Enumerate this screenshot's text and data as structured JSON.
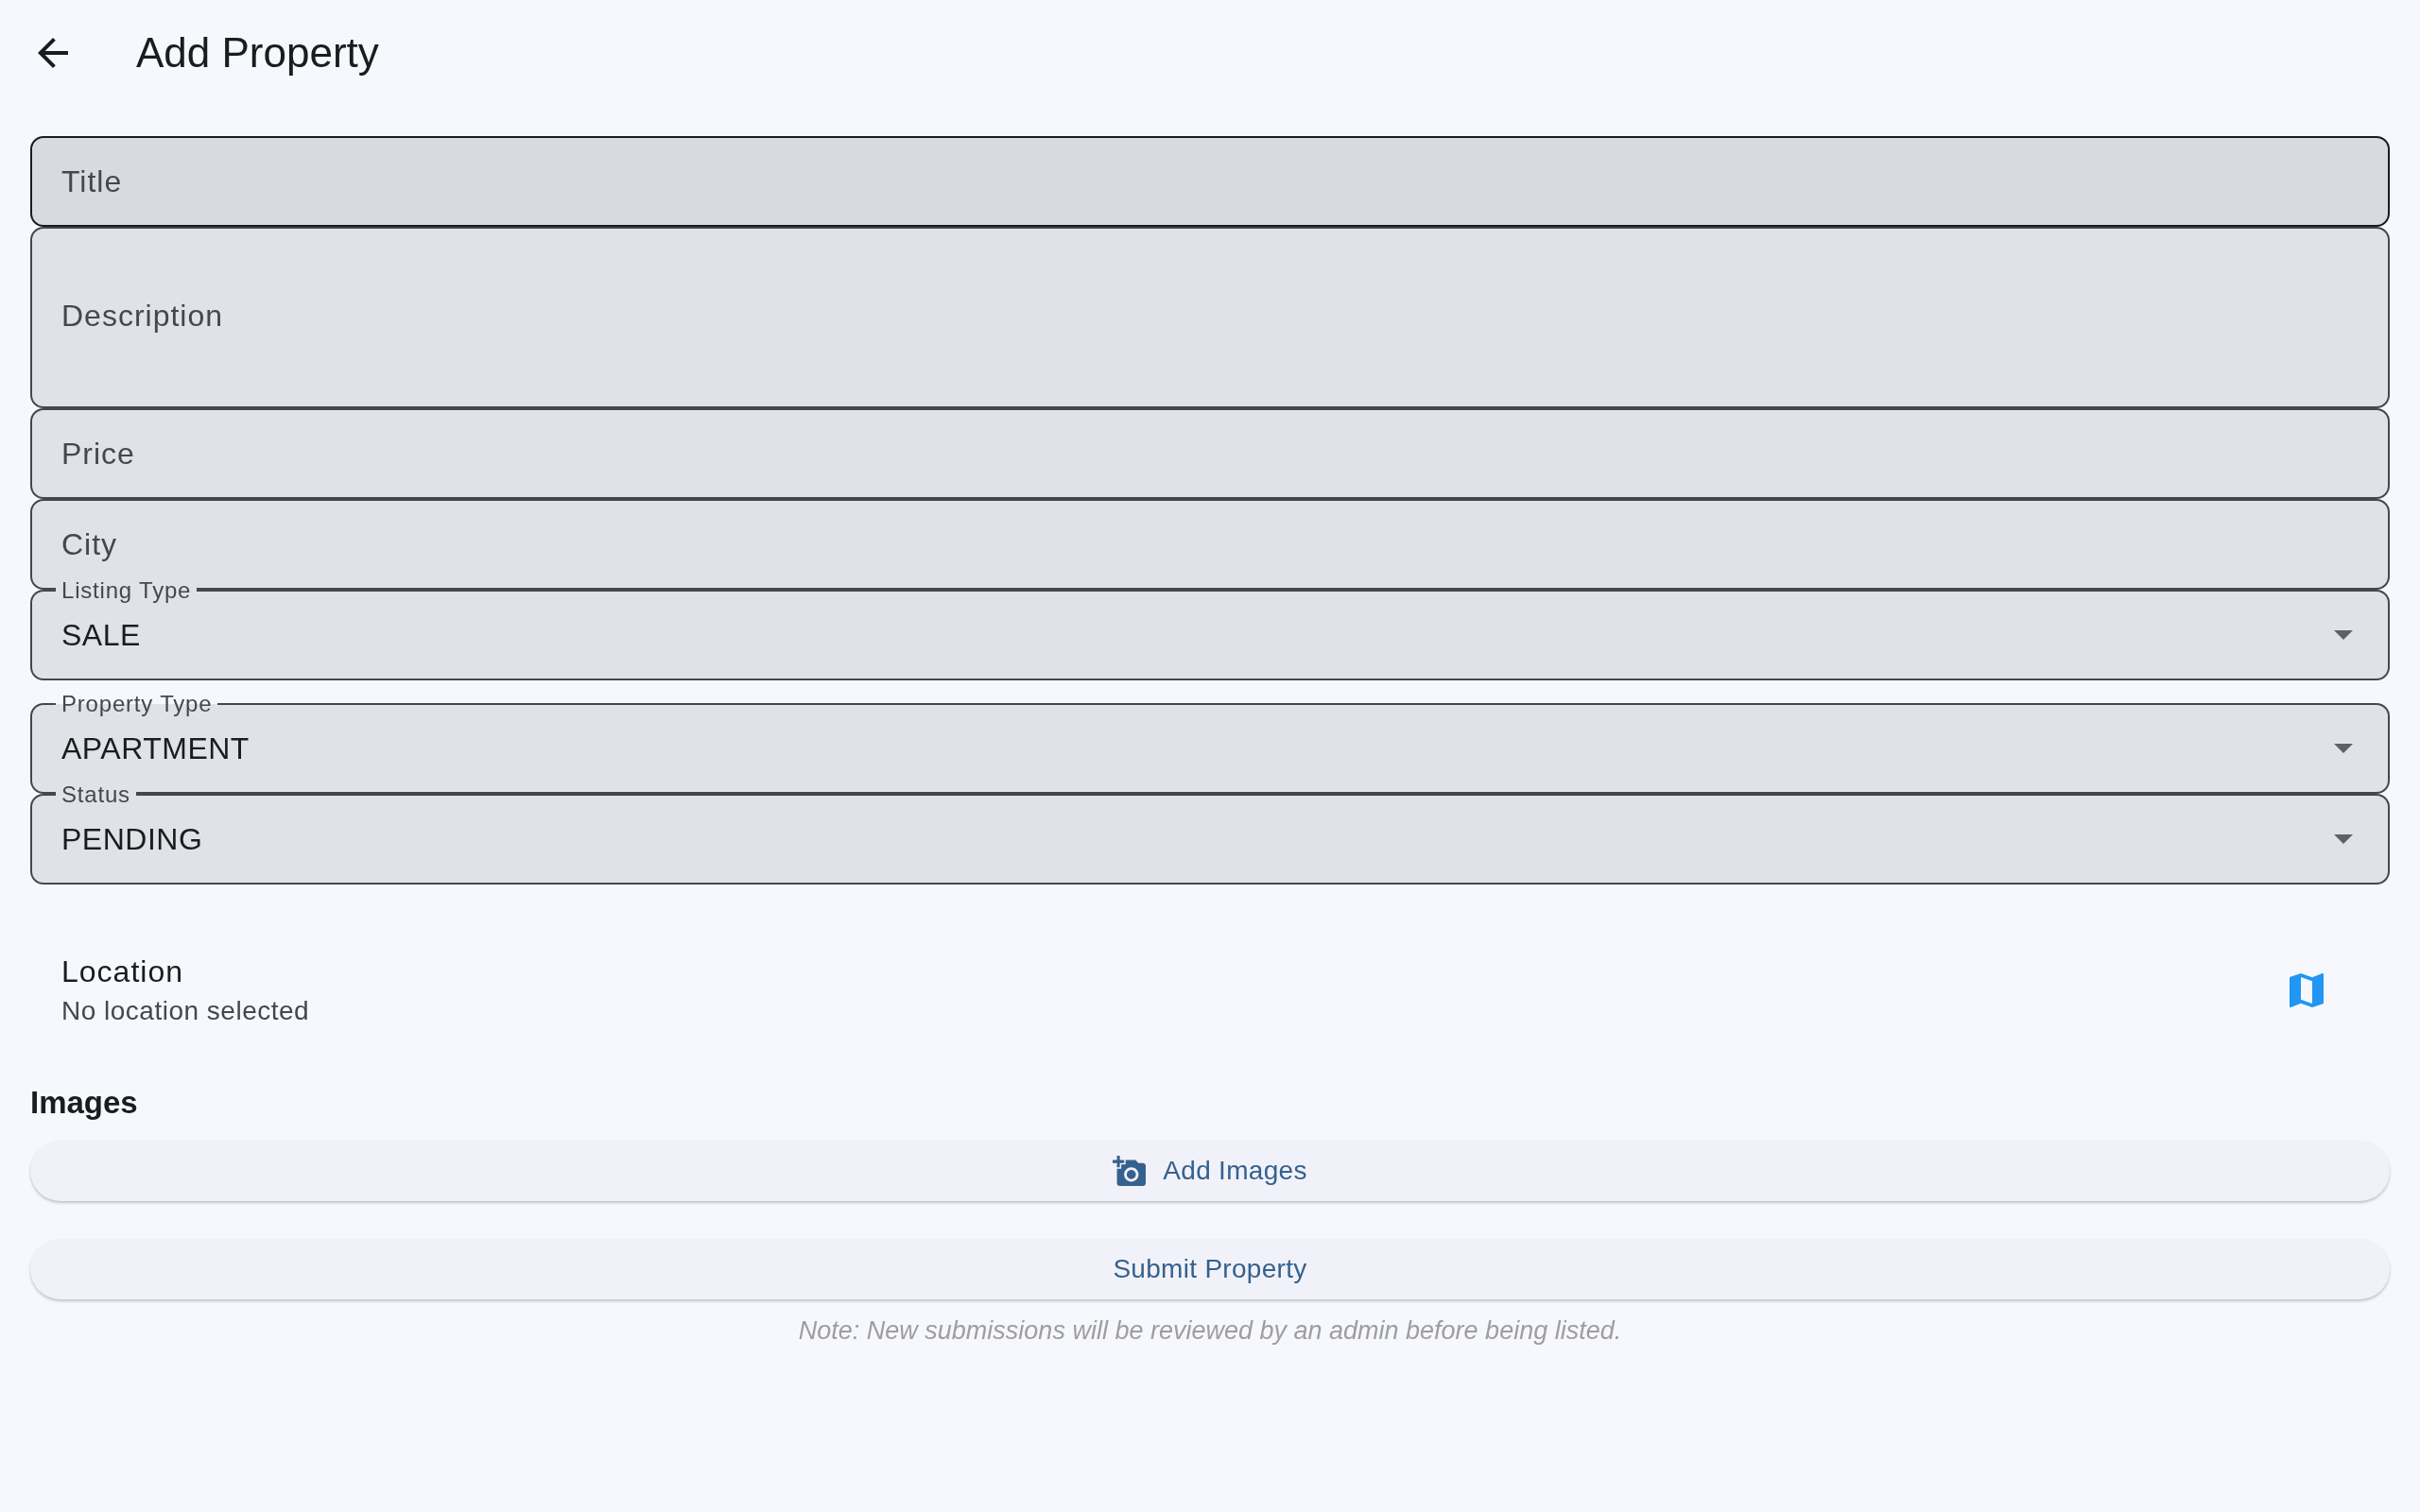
{
  "app_bar": {
    "title": "Add Property"
  },
  "fields": [
    {
      "kind": "text",
      "placeholder": "Title",
      "hovered": true
    },
    {
      "kind": "multiline",
      "placeholder": "Description",
      "hovered": false
    },
    {
      "kind": "text",
      "placeholder": "Price",
      "hovered": false
    },
    {
      "kind": "text",
      "placeholder": "City",
      "hovered": false
    },
    {
      "kind": "dropdown",
      "label": "Listing Type",
      "value": "SALE",
      "hovered": false
    },
    {
      "kind": "dropdown",
      "label": "Property Type",
      "value": "APARTMENT",
      "hovered": false
    },
    {
      "kind": "dropdown",
      "label": "Status",
      "value": "PENDING",
      "hovered": false
    }
  ],
  "location": {
    "title": "Location",
    "subtitle": "No location selected"
  },
  "images": {
    "heading": "Images",
    "button": "Add Images"
  },
  "submit_button": "Submit Property",
  "note": "Note: New submissions will be reviewed by an admin before being listed."
}
